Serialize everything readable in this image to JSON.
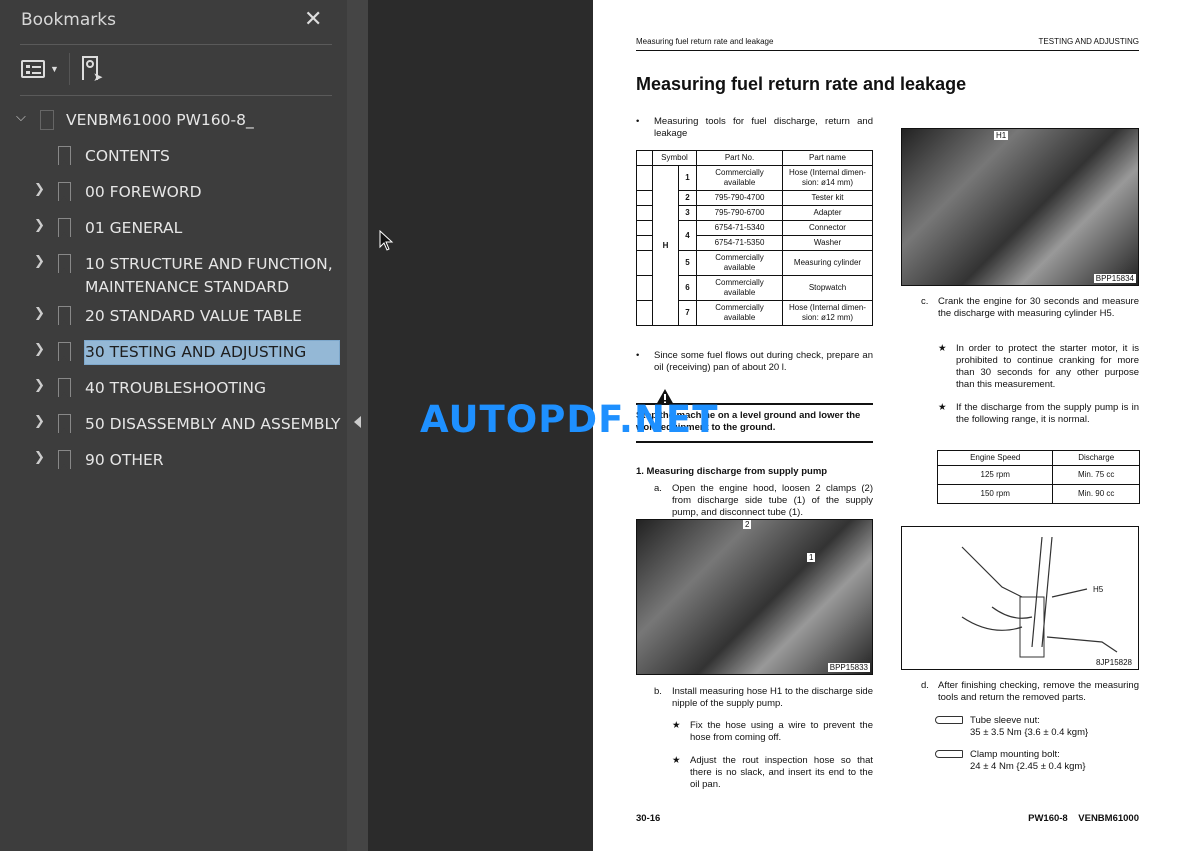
{
  "sidebar": {
    "title": "Bookmarks",
    "close": "✕",
    "tools": {
      "options": "list-options-icon",
      "find": "find-bookmark-icon"
    },
    "root": "VENBM61000 PW160-8_",
    "items": [
      {
        "label": "CONTENTS",
        "expandable": false
      },
      {
        "label": "00 FOREWORD",
        "expandable": true
      },
      {
        "label": "01 GENERAL",
        "expandable": true
      },
      {
        "label": "10 STRUCTURE AND FUNCTION,",
        "label2": "MAINTENANCE STANDARD",
        "expandable": true
      },
      {
        "label": "20 STANDARD VALUE TABLE",
        "expandable": true
      },
      {
        "label": "30 TESTING AND ADJUSTING",
        "expandable": true,
        "selected": true
      },
      {
        "label": "40 TROUBLESHOOTING",
        "expandable": true
      },
      {
        "label": "50 DISASSEMBLY AND ASSEMBLY",
        "expandable": true
      },
      {
        "label": "90 OTHER",
        "expandable": true
      }
    ]
  },
  "watermark": "AUTOPDF.NET",
  "page": {
    "header_left": "Measuring fuel return rate and leakage",
    "header_right": "TESTING AND ADJUSTING",
    "title": "Measuring fuel return rate and leakage",
    "bullet1": "Measuring tools for fuel discharge, return and leakage",
    "tools_table": {
      "headers": [
        "Symbol",
        "Part No.",
        "Part name"
      ],
      "symbol": "H",
      "rows": [
        [
          "1",
          "Commercially available",
          "Hose (Internal dimen- sion: ø14 mm)"
        ],
        [
          "2",
          "795-790-4700",
          "Tester kit"
        ],
        [
          "3",
          "795-790-6700",
          "Adapter"
        ],
        [
          "4",
          "6754-71-5340",
          "Connector"
        ],
        [
          "",
          "6754-71-5350",
          "Washer"
        ],
        [
          "5",
          "Commercially available",
          "Measuring cylinder"
        ],
        [
          "6",
          "Commercially available",
          "Stopwatch"
        ],
        [
          "7",
          "Commercially available",
          "Hose (Internal dimen- sion: ø12 mm)"
        ]
      ]
    },
    "bullet2": "Since some fuel flows out during check, prepare an oil (receiving) pan of about 20 l.",
    "warning": "Stop the machine on a level ground and lower the work equipment to the ground.",
    "step1": "1.   Measuring discharge from supply pump",
    "step_a": "a.",
    "step_a_text": "Open the engine hood, loosen 2 clamps (2) from discharge side tube (1) of the supply pump, and disconnect tube (1).",
    "photo1": {
      "code": "BPP15833",
      "l1": "2",
      "l2": "1"
    },
    "step_b": "b.",
    "step_b_text": "Install measuring hose H1 to the discharge side nipple of the supply pump.",
    "star_b1": "Fix the hose using a wire to prevent the hose from coming off.",
    "star_b2": "Adjust the rout inspection hose so that there is no slack, and insert its end to the oil pan.",
    "photo2": {
      "code": "BPP15834",
      "l1": "H1"
    },
    "step_c": "c.",
    "step_c_text": "Crank the engine for 30 seconds and measure the discharge with measuring cylinder H5.",
    "star_c1": "In order to protect the starter motor, it is prohibited to continue cranking for more than 30 seconds for any other purpose than this measurement.",
    "star_c2": "If the discharge from the supply pump is in the following range, it is normal.",
    "discharge_table": {
      "headers": [
        "Engine Speed",
        "Discharge"
      ],
      "rows": [
        [
          "125 rpm",
          "Min. 75 cc"
        ],
        [
          "150 rpm",
          "Min. 90 cc"
        ]
      ]
    },
    "drawing": {
      "code": "8JP15828",
      "l1": "H5"
    },
    "step_d": "d.",
    "step_d_text": "After finishing checking, remove the measuring tools and return the removed parts.",
    "torque1_label": "Tube sleeve nut:",
    "torque1_value": "35 ± 3.5 Nm {3.6 ± 0.4 kgm}",
    "torque2_label": "Clamp mounting bolt:",
    "torque2_value": "24 ± 4 Nm {2.45 ± 0.4 kgm}",
    "footer_left": "30-16",
    "footer_right": "PW160-8    VENBM61000"
  }
}
